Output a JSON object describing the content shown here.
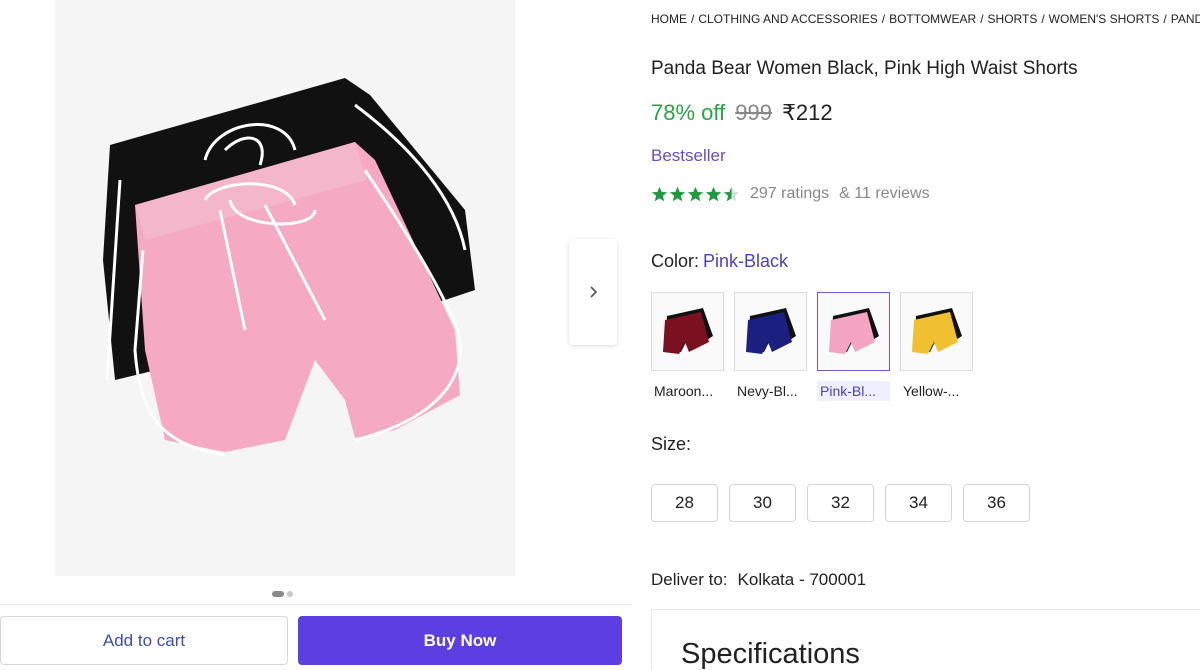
{
  "breadcrumb": [
    "HOME",
    "CLOTHING AND ACCESSORIES",
    "BOTTOMWEAR",
    "SHORTS",
    "WOMEN'S SHORTS",
    "PANDA"
  ],
  "product": {
    "title": "Panda Bear Women Black, Pink High Waist Shorts",
    "discount": "78% off",
    "mrp": "999",
    "price": "₹212",
    "badge": "Bestseller",
    "rating_value": 4.5,
    "ratings_text": "297 ratings",
    "reviews_text": "& 11 reviews"
  },
  "color": {
    "label": "Color:",
    "selected": "Pink-Black",
    "options": [
      {
        "label": "Maroon...",
        "main_color": "#7a1020"
      },
      {
        "label": "Nevy-Bl...",
        "main_color": "#1a1f80"
      },
      {
        "label": "Pink-Bl...",
        "main_color": "#f4a4c0"
      },
      {
        "label": "Yellow-...",
        "main_color": "#f0c030"
      }
    ]
  },
  "size": {
    "label": "Size:",
    "options": [
      "28",
      "30",
      "32",
      "34",
      "36"
    ]
  },
  "delivery": {
    "label": "Deliver to:",
    "location": "Kolkata - 700001"
  },
  "specifications": {
    "title": "Specifications"
  },
  "actions": {
    "add_to_cart": "Add to cart",
    "buy_now": "Buy Now"
  },
  "colors": {
    "accent": "#5b3fe0",
    "discount": "#26a541",
    "star": "#1f9a40"
  }
}
